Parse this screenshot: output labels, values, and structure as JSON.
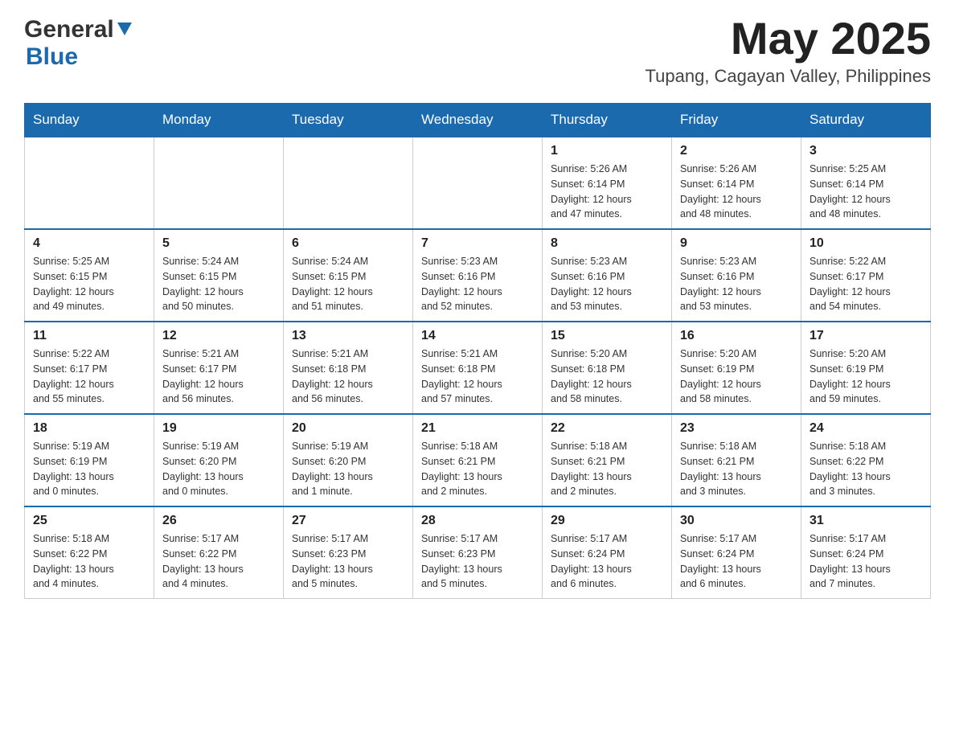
{
  "header": {
    "logo": {
      "general": "General",
      "blue": "Blue"
    },
    "month_title": "May 2025",
    "location": "Tupang, Cagayan Valley, Philippines"
  },
  "weekdays": [
    "Sunday",
    "Monday",
    "Tuesday",
    "Wednesday",
    "Thursday",
    "Friday",
    "Saturday"
  ],
  "weeks": [
    [
      {
        "day": "",
        "info": ""
      },
      {
        "day": "",
        "info": ""
      },
      {
        "day": "",
        "info": ""
      },
      {
        "day": "",
        "info": ""
      },
      {
        "day": "1",
        "info": "Sunrise: 5:26 AM\nSunset: 6:14 PM\nDaylight: 12 hours\nand 47 minutes."
      },
      {
        "day": "2",
        "info": "Sunrise: 5:26 AM\nSunset: 6:14 PM\nDaylight: 12 hours\nand 48 minutes."
      },
      {
        "day": "3",
        "info": "Sunrise: 5:25 AM\nSunset: 6:14 PM\nDaylight: 12 hours\nand 48 minutes."
      }
    ],
    [
      {
        "day": "4",
        "info": "Sunrise: 5:25 AM\nSunset: 6:15 PM\nDaylight: 12 hours\nand 49 minutes."
      },
      {
        "day": "5",
        "info": "Sunrise: 5:24 AM\nSunset: 6:15 PM\nDaylight: 12 hours\nand 50 minutes."
      },
      {
        "day": "6",
        "info": "Sunrise: 5:24 AM\nSunset: 6:15 PM\nDaylight: 12 hours\nand 51 minutes."
      },
      {
        "day": "7",
        "info": "Sunrise: 5:23 AM\nSunset: 6:16 PM\nDaylight: 12 hours\nand 52 minutes."
      },
      {
        "day": "8",
        "info": "Sunrise: 5:23 AM\nSunset: 6:16 PM\nDaylight: 12 hours\nand 53 minutes."
      },
      {
        "day": "9",
        "info": "Sunrise: 5:23 AM\nSunset: 6:16 PM\nDaylight: 12 hours\nand 53 minutes."
      },
      {
        "day": "10",
        "info": "Sunrise: 5:22 AM\nSunset: 6:17 PM\nDaylight: 12 hours\nand 54 minutes."
      }
    ],
    [
      {
        "day": "11",
        "info": "Sunrise: 5:22 AM\nSunset: 6:17 PM\nDaylight: 12 hours\nand 55 minutes."
      },
      {
        "day": "12",
        "info": "Sunrise: 5:21 AM\nSunset: 6:17 PM\nDaylight: 12 hours\nand 56 minutes."
      },
      {
        "day": "13",
        "info": "Sunrise: 5:21 AM\nSunset: 6:18 PM\nDaylight: 12 hours\nand 56 minutes."
      },
      {
        "day": "14",
        "info": "Sunrise: 5:21 AM\nSunset: 6:18 PM\nDaylight: 12 hours\nand 57 minutes."
      },
      {
        "day": "15",
        "info": "Sunrise: 5:20 AM\nSunset: 6:18 PM\nDaylight: 12 hours\nand 58 minutes."
      },
      {
        "day": "16",
        "info": "Sunrise: 5:20 AM\nSunset: 6:19 PM\nDaylight: 12 hours\nand 58 minutes."
      },
      {
        "day": "17",
        "info": "Sunrise: 5:20 AM\nSunset: 6:19 PM\nDaylight: 12 hours\nand 59 minutes."
      }
    ],
    [
      {
        "day": "18",
        "info": "Sunrise: 5:19 AM\nSunset: 6:19 PM\nDaylight: 13 hours\nand 0 minutes."
      },
      {
        "day": "19",
        "info": "Sunrise: 5:19 AM\nSunset: 6:20 PM\nDaylight: 13 hours\nand 0 minutes."
      },
      {
        "day": "20",
        "info": "Sunrise: 5:19 AM\nSunset: 6:20 PM\nDaylight: 13 hours\nand 1 minute."
      },
      {
        "day": "21",
        "info": "Sunrise: 5:18 AM\nSunset: 6:21 PM\nDaylight: 13 hours\nand 2 minutes."
      },
      {
        "day": "22",
        "info": "Sunrise: 5:18 AM\nSunset: 6:21 PM\nDaylight: 13 hours\nand 2 minutes."
      },
      {
        "day": "23",
        "info": "Sunrise: 5:18 AM\nSunset: 6:21 PM\nDaylight: 13 hours\nand 3 minutes."
      },
      {
        "day": "24",
        "info": "Sunrise: 5:18 AM\nSunset: 6:22 PM\nDaylight: 13 hours\nand 3 minutes."
      }
    ],
    [
      {
        "day": "25",
        "info": "Sunrise: 5:18 AM\nSunset: 6:22 PM\nDaylight: 13 hours\nand 4 minutes."
      },
      {
        "day": "26",
        "info": "Sunrise: 5:17 AM\nSunset: 6:22 PM\nDaylight: 13 hours\nand 4 minutes."
      },
      {
        "day": "27",
        "info": "Sunrise: 5:17 AM\nSunset: 6:23 PM\nDaylight: 13 hours\nand 5 minutes."
      },
      {
        "day": "28",
        "info": "Sunrise: 5:17 AM\nSunset: 6:23 PM\nDaylight: 13 hours\nand 5 minutes."
      },
      {
        "day": "29",
        "info": "Sunrise: 5:17 AM\nSunset: 6:24 PM\nDaylight: 13 hours\nand 6 minutes."
      },
      {
        "day": "30",
        "info": "Sunrise: 5:17 AM\nSunset: 6:24 PM\nDaylight: 13 hours\nand 6 minutes."
      },
      {
        "day": "31",
        "info": "Sunrise: 5:17 AM\nSunset: 6:24 PM\nDaylight: 13 hours\nand 7 minutes."
      }
    ]
  ]
}
